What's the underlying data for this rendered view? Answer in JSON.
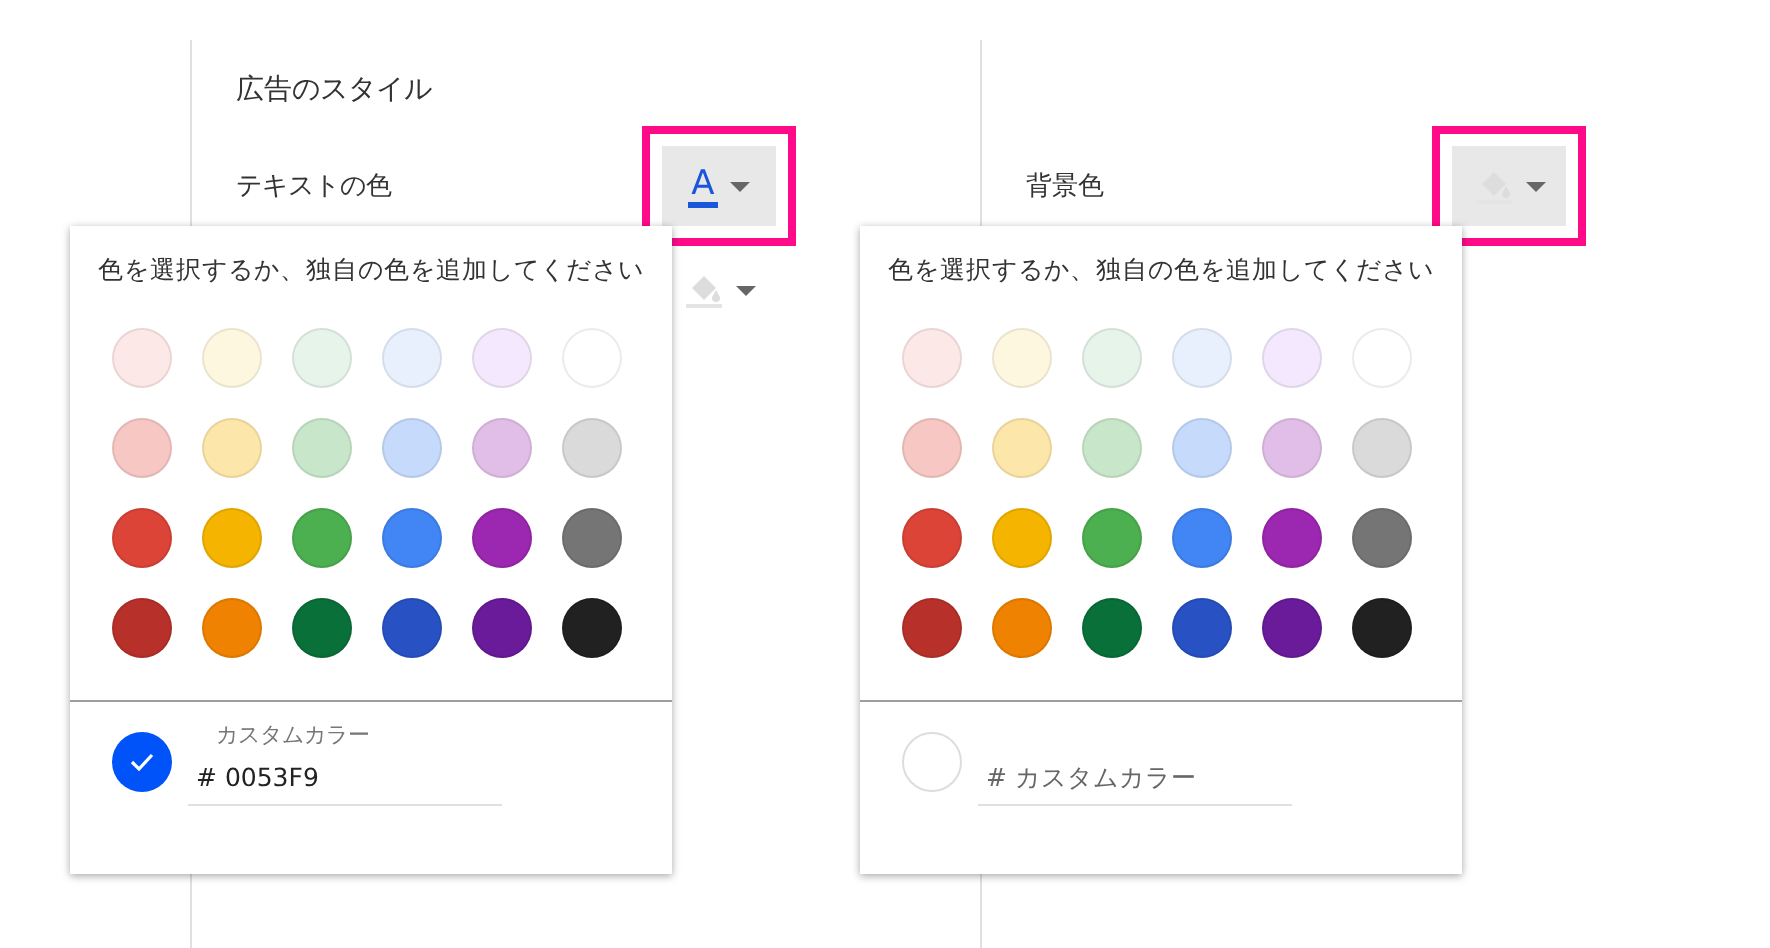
{
  "section_title": "広告のスタイル",
  "pickers": [
    {
      "label": "テキストの色",
      "button": {
        "kind": "text",
        "glyph": "A",
        "highlighted": true
      },
      "extra_button": {
        "kind": "fill",
        "highlighted": false
      },
      "popup": {
        "prompt": "色を選択するか、独自の色を追加してください",
        "swatches": [
          {
            "color": "#fce8e6"
          },
          {
            "color": "#fef7e0"
          },
          {
            "color": "#e6f4ea"
          },
          {
            "color": "#e8f0fe"
          },
          {
            "color": "#f3e8fd"
          },
          {
            "color": "#ffffff"
          },
          {
            "color": "#f6c7c3"
          },
          {
            "color": "#fce6a9"
          },
          {
            "color": "#c8e6c9"
          },
          {
            "color": "#c6dafc"
          },
          {
            "color": "#e1bee7"
          },
          {
            "color": "#dadada"
          },
          {
            "color": "#db4437"
          },
          {
            "color": "#f4b400"
          },
          {
            "color": "#4caf50"
          },
          {
            "color": "#4285f4"
          },
          {
            "color": "#9c27b0"
          },
          {
            "color": "#757575"
          },
          {
            "color": "#b7312a"
          },
          {
            "color": "#ef8200"
          },
          {
            "color": "#0a7039"
          },
          {
            "color": "#2851c4"
          },
          {
            "color": "#6a1b9a"
          },
          {
            "color": "#212121"
          }
        ],
        "custom": {
          "label": "カスタムカラー",
          "value": "# 0053F9",
          "checked": true,
          "color": "#0053f9"
        }
      }
    },
    {
      "label": "背景色",
      "button": {
        "kind": "fill",
        "highlighted": true
      },
      "popup": {
        "prompt": "色を選択するか、独自の色を追加してください",
        "swatches": [
          {
            "color": "#fce8e6"
          },
          {
            "color": "#fef7e0"
          },
          {
            "color": "#e6f4ea"
          },
          {
            "color": "#e8f0fe"
          },
          {
            "color": "#f3e8fd"
          },
          {
            "color": "#ffffff"
          },
          {
            "color": "#f6c7c3"
          },
          {
            "color": "#fce6a9"
          },
          {
            "color": "#c8e6c9"
          },
          {
            "color": "#c6dafc"
          },
          {
            "color": "#e1bee7"
          },
          {
            "color": "#dadada"
          },
          {
            "color": "#db4437"
          },
          {
            "color": "#f4b400"
          },
          {
            "color": "#4caf50"
          },
          {
            "color": "#4285f4"
          },
          {
            "color": "#9c27b0"
          },
          {
            "color": "#757575"
          },
          {
            "color": "#b7312a"
          },
          {
            "color": "#ef8200"
          },
          {
            "color": "#0a7039"
          },
          {
            "color": "#2851c4"
          },
          {
            "color": "#6a1b9a"
          },
          {
            "color": "#212121"
          }
        ],
        "custom": {
          "placeholder": "# カスタムカラー",
          "checked": false
        }
      }
    }
  ]
}
